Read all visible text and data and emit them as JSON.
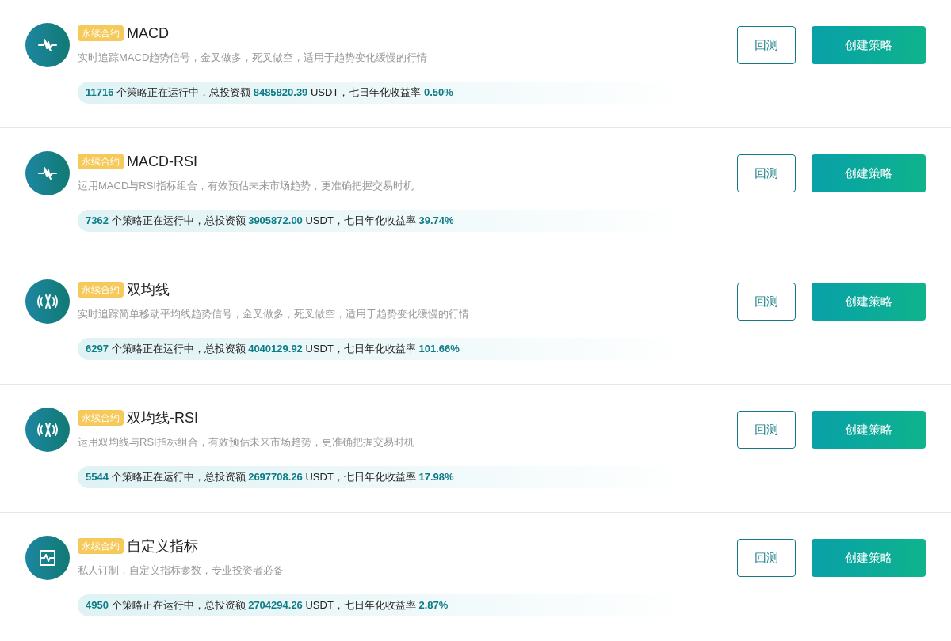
{
  "strategies": [
    {
      "kind": "macd",
      "tag": "永续合约",
      "name": "MACD",
      "description": "实时追踪MACD趋势信号，金叉做多，死叉做空，适用于趋势变化缓慢的行情",
      "stats": "**11716** 个策略正在运行中，总投资额 **8485820.39** USDT，七日年化收益率 **0.50%**",
      "backtest": "回测",
      "create": "创建策略"
    },
    {
      "kind": "macd",
      "tag": "永续合约",
      "name": "MACD-RSI",
      "description": "运用MACD与RSI指标组合，有效预估未来市场趋势，更准确把握交易时机",
      "stats": "**7362** 个策略正在运行中，总投资额 **3905872.00** USDT，七日年化收益率 **39.74%**",
      "backtest": "回测",
      "create": "创建策略"
    },
    {
      "kind": "average",
      "tag": "永续合约",
      "name": "双均线",
      "description": "实时追踪简单移动平均线趋势信号，金叉做多，死叉做空，适用于趋势变化缓慢的行情",
      "stats": "**6297** 个策略正在运行中，总投资额 **4040129.92** USDT，七日年化收益率 **101.66%**",
      "backtest": "回测",
      "create": "创建策略"
    },
    {
      "kind": "average",
      "tag": "永续合约",
      "name": "双均线-RSI",
      "description": "运用双均线与RSI指标组合，有效预估未来市场趋势，更准确把握交易时机",
      "stats": "**5544** 个策略正在运行中，总投资额 **2697708.26** USDT，七日年化收益率 **17.98%**",
      "backtest": "回测",
      "create": "创建策略"
    },
    {
      "kind": "custom",
      "tag": "永续合约",
      "name": "自定义指标",
      "description": "私人订制，自定义指标参数，专业投资者必备",
      "stats": "**4950** 个策略正在运行中，总投资额 **2704294.26** USDT，七日年化收益率 **2.87%**",
      "backtest": "回测",
      "create": "创建策略"
    }
  ]
}
